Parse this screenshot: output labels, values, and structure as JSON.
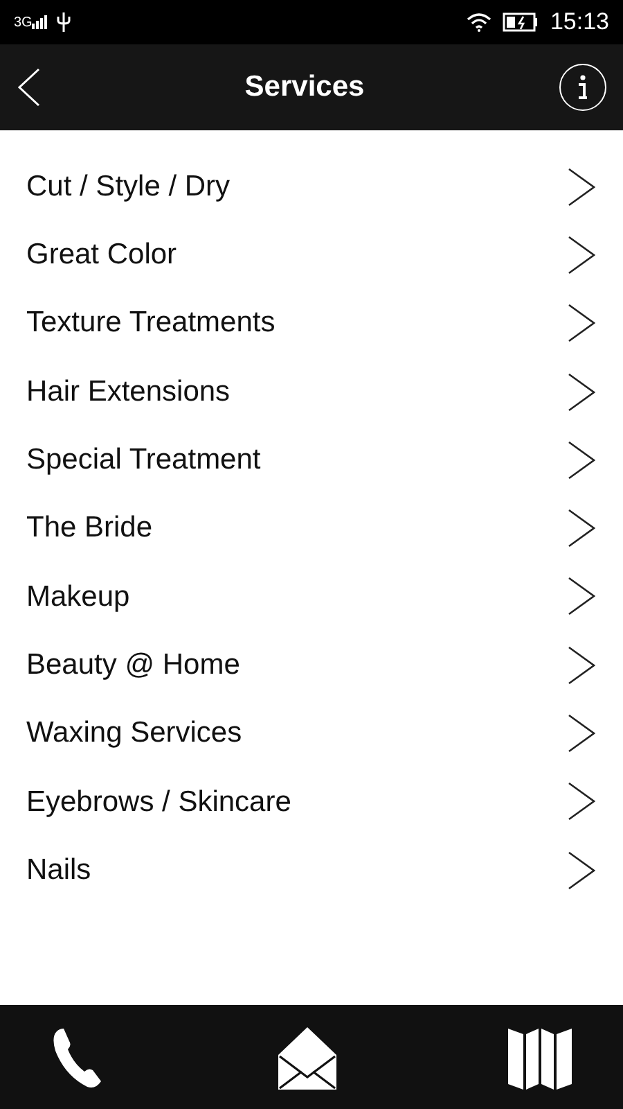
{
  "status_bar": {
    "network": "3G",
    "time": "15:13"
  },
  "header": {
    "title": "Services"
  },
  "services": [
    {
      "label": "Cut / Style / Dry"
    },
    {
      "label": "Great Color"
    },
    {
      "label": "Texture Treatments"
    },
    {
      "label": "Hair Extensions"
    },
    {
      "label": "Special Treatment"
    },
    {
      "label": "The Bride"
    },
    {
      "label": "Makeup"
    },
    {
      "label": "Beauty @ Home"
    },
    {
      "label": "Waxing Services"
    },
    {
      "label": "Eyebrows / Skincare"
    },
    {
      "label": "Nails"
    }
  ]
}
